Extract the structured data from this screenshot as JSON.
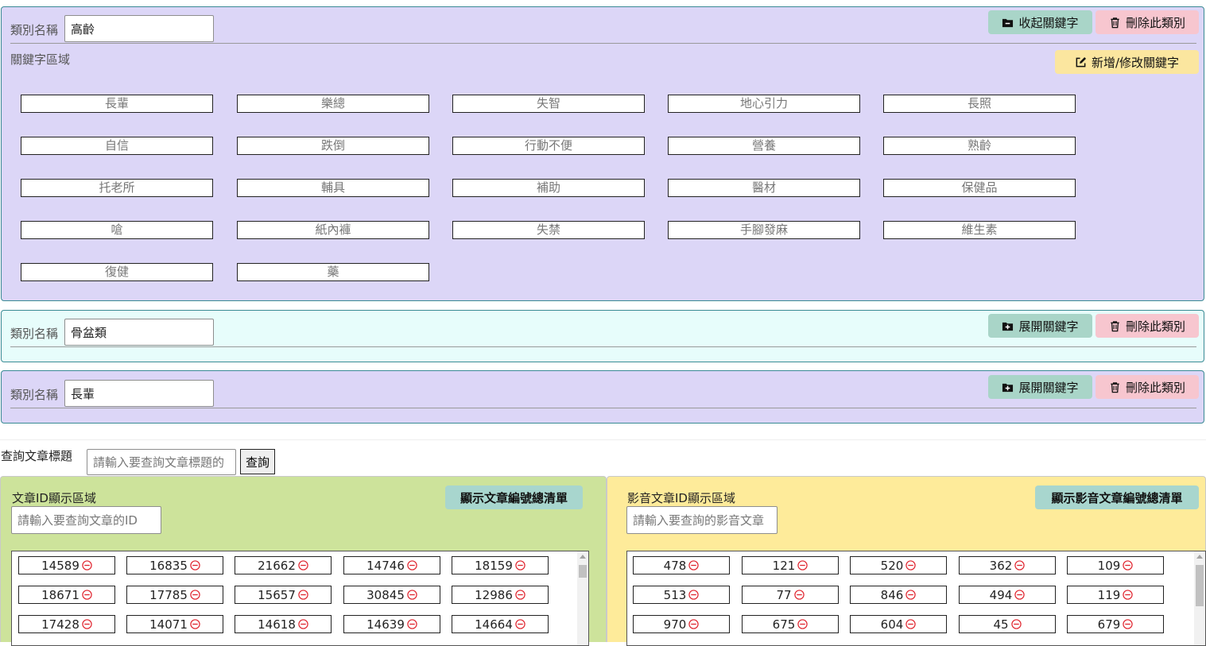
{
  "categories": [
    {
      "label": "類別名稱",
      "name": "高齡",
      "toggle_label": "收起關鍵字",
      "delete_label": "刪除此類別",
      "keyword_area_title": "關鍵字區域",
      "edit_keywords_label": "新增/修改關鍵字",
      "keywords": [
        "長輩",
        "樂總",
        "失智",
        "地心引力",
        "長照",
        "自信",
        "跌倒",
        "行動不便",
        "營養",
        "熟齡",
        "托老所",
        "輔具",
        "補助",
        "醫材",
        "保健品",
        "嗆",
        "紙內褲",
        "失禁",
        "手腳發麻",
        "維生素",
        "復健",
        "藥"
      ]
    },
    {
      "label": "類別名稱",
      "name": "骨盆類",
      "toggle_label": "展開關鍵字",
      "delete_label": "刪除此類別"
    },
    {
      "label": "類別名稱",
      "name": "長輩",
      "toggle_label": "展開關鍵字",
      "delete_label": "刪除此類別"
    }
  ],
  "query": {
    "label": "查詢文章標題",
    "placeholder": "請輸入要查詢文章標題的",
    "button": "查詢"
  },
  "article_area": {
    "title": "文章ID顯示區域",
    "button": "顯示文章編號總清單",
    "placeholder": "請輸入要查詢文章的ID",
    "ids": [
      "14589",
      "16835",
      "21662",
      "14746",
      "18159",
      "18671",
      "17785",
      "15657",
      "30845",
      "12986",
      "17428",
      "14071",
      "14618",
      "14639",
      "14664"
    ]
  },
  "video_area": {
    "title": "影音文章ID顯示區域",
    "button": "顯示影音文章編號總清單",
    "placeholder": "請輸入要查詢的影音文章",
    "ids": [
      "478",
      "121",
      "520",
      "362",
      "109",
      "513",
      "77",
      "846",
      "494",
      "119",
      "970",
      "675",
      "604",
      "45",
      "679"
    ]
  },
  "colors": {
    "panel_purple": "#dcd6f7",
    "panel_cyan": "#e7fdfb",
    "article_bg": "#cde39b",
    "video_bg": "#feeb9a",
    "remove_icon": "#e0242e"
  },
  "icons": {
    "collapse": "folder-minus-icon",
    "expand": "folder-plus-icon",
    "delete": "trash-icon",
    "edit": "edit-icon",
    "remove_id": "minus-circle-icon"
  }
}
